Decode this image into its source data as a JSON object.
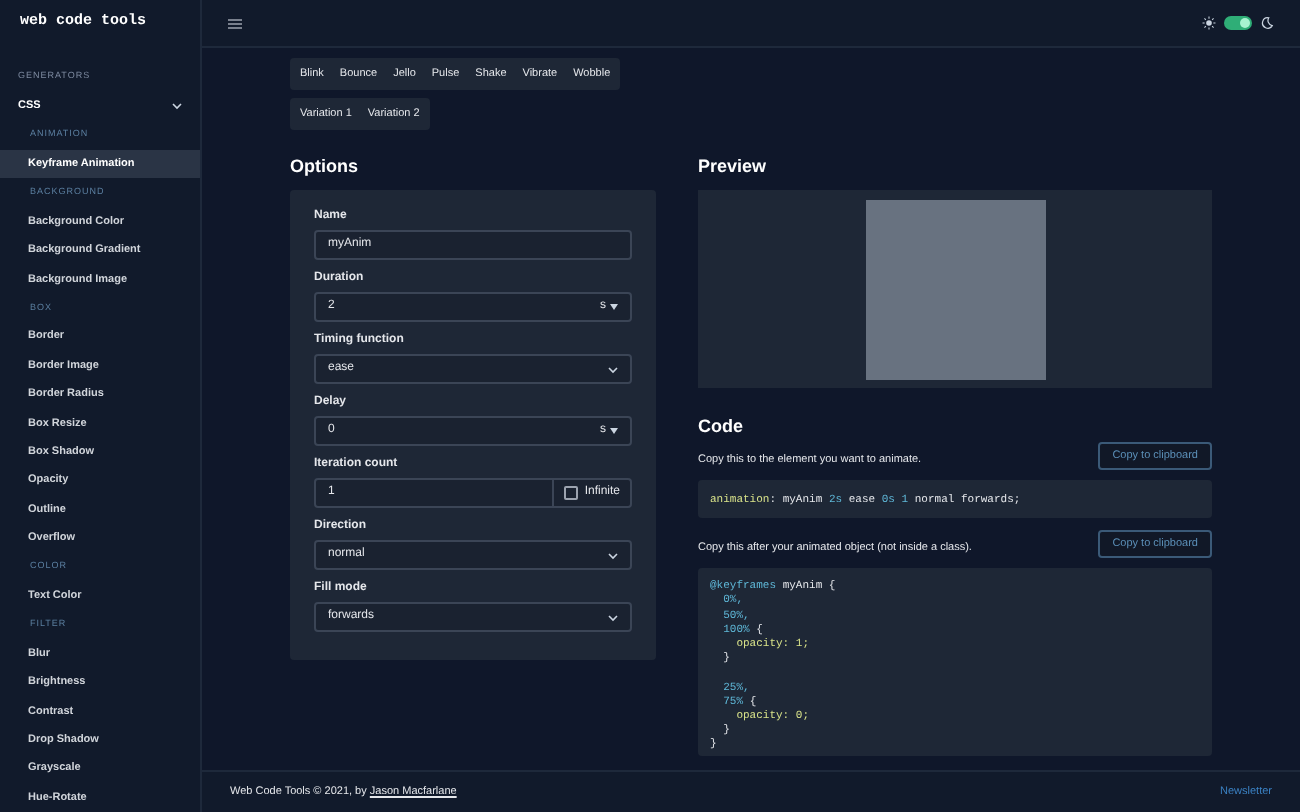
{
  "sidebar": {
    "logo": "web code tools",
    "heading": "GENERATORS",
    "group": {
      "label": "CSS",
      "expanded": true,
      "sections": [
        {
          "label": "ANIMATION",
          "items": [
            {
              "label": "Keyframe Animation",
              "selected": true
            }
          ]
        },
        {
          "label": "BACKGROUND",
          "items": [
            {
              "label": "Background Color",
              "selected": false
            },
            {
              "label": "Background Gradient",
              "selected": false
            },
            {
              "label": "Background Image",
              "selected": false
            }
          ]
        },
        {
          "label": "BOX",
          "items": [
            {
              "label": "Border",
              "selected": false
            },
            {
              "label": "Border Image",
              "selected": false
            },
            {
              "label": "Border Radius",
              "selected": false
            },
            {
              "label": "Box Resize",
              "selected": false
            },
            {
              "label": "Box Shadow",
              "selected": false
            },
            {
              "label": "Opacity",
              "selected": false
            },
            {
              "label": "Outline",
              "selected": false
            },
            {
              "label": "Overflow",
              "selected": false
            }
          ]
        },
        {
          "label": "COLOR",
          "items": [
            {
              "label": "Text Color",
              "selected": false
            }
          ]
        },
        {
          "label": "FILTER",
          "items": [
            {
              "label": "Blur",
              "selected": false
            },
            {
              "label": "Brightness",
              "selected": false
            },
            {
              "label": "Contrast",
              "selected": false
            },
            {
              "label": "Drop Shadow",
              "selected": false
            },
            {
              "label": "Grayscale",
              "selected": false
            },
            {
              "label": "Hue-Rotate",
              "selected": false
            }
          ]
        }
      ]
    }
  },
  "header": {
    "theme_toggle": {
      "on": true
    }
  },
  "presets": [
    [
      "Blink",
      "Bounce",
      "Jello",
      "Pulse",
      "Shake",
      "Vibrate",
      "Wobble"
    ],
    [
      "Variation 1",
      "Variation 2"
    ]
  ],
  "options": {
    "title": "Options",
    "fields": [
      {
        "label": "Name",
        "kind": "text",
        "value": "myAnim"
      },
      {
        "label": "Duration",
        "kind": "number",
        "value": "2",
        "unit": "s"
      },
      {
        "label": "Timing function",
        "kind": "select",
        "value": "ease"
      },
      {
        "label": "Delay",
        "kind": "number",
        "value": "0",
        "unit": "s"
      },
      {
        "label": "Iteration count",
        "kind": "count",
        "value": "1",
        "checkbox_label": "Infinite",
        "checked": false
      },
      {
        "label": "Direction",
        "kind": "select",
        "value": "normal"
      },
      {
        "label": "Fill mode",
        "kind": "select",
        "value": "forwards"
      }
    ]
  },
  "preview": {
    "title": "Preview"
  },
  "code": {
    "title": "Code",
    "blocks": [
      {
        "instruction": "Copy this to the element you want to animate.",
        "button": "Copy to clipboard",
        "lines": [
          {
            "kind": "code",
            "tokens": [
              {
                "text": "animation",
                "kind": "property"
              },
              {
                "text": ": myAnim ",
                "kind": "plain"
              },
              {
                "text": "2s",
                "kind": "number"
              },
              {
                "text": " ease ",
                "kind": "plain"
              },
              {
                "text": "0s 1",
                "kind": "number"
              },
              {
                "text": " normal forwards;",
                "kind": "plain"
              }
            ]
          }
        ]
      },
      {
        "instruction": "Copy this after your animated object (not inside a class).",
        "button": "Copy to clipboard",
        "lines": [
          {
            "kind": "code",
            "tokens": [
              {
                "text": "@keyframes",
                "kind": "keyword"
              },
              {
                "text": " myAnim {",
                "kind": "plain"
              }
            ]
          },
          {
            "kind": "code",
            "tokens": [
              {
                "text": "  0%,",
                "kind": "number"
              }
            ]
          },
          {
            "kind": "code",
            "tokens": [
              {
                "text": "  50%,",
                "kind": "number"
              }
            ]
          },
          {
            "kind": "code",
            "tokens": [
              {
                "text": "  100%",
                "kind": "number"
              },
              {
                "text": " {",
                "kind": "plain"
              }
            ]
          },
          {
            "kind": "code",
            "tokens": [
              {
                "text": "    opacity: 1;",
                "kind": "property"
              }
            ]
          },
          {
            "kind": "code",
            "tokens": [
              {
                "text": "  }",
                "kind": "plain"
              }
            ]
          },
          {
            "kind": "blank"
          },
          {
            "kind": "code",
            "tokens": [
              {
                "text": "  25%,",
                "kind": "number"
              }
            ]
          },
          {
            "kind": "code",
            "tokens": [
              {
                "text": "  75%",
                "kind": "number"
              },
              {
                "text": " {",
                "kind": "plain"
              }
            ]
          },
          {
            "kind": "code",
            "tokens": [
              {
                "text": "    opacity: 0;",
                "kind": "property"
              }
            ]
          },
          {
            "kind": "code",
            "tokens": [
              {
                "text": "  }",
                "kind": "plain"
              }
            ]
          },
          {
            "kind": "code",
            "tokens": [
              {
                "text": "}",
                "kind": "plain"
              }
            ]
          }
        ]
      }
    ]
  },
  "footer": {
    "credit": "Web Code Tools © 2021, by",
    "author": "Jason Macfarlane",
    "link": "Newsletter"
  }
}
